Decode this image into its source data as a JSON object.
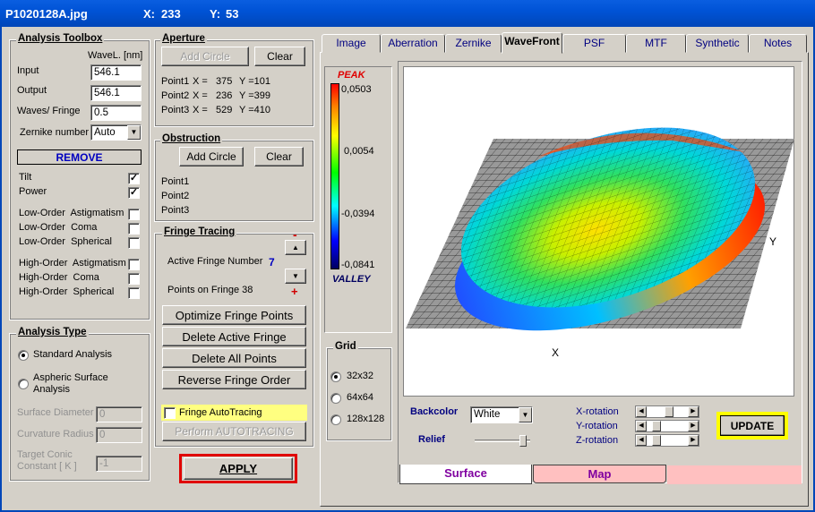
{
  "title": {
    "file": "P1020128A.jpg",
    "x_label": "X:",
    "x_value": "233",
    "y_label": "Y:",
    "y_value": "53"
  },
  "toolbox": {
    "title": "Analysis Toolbox",
    "wavel_header": "WaveL. [nm]",
    "input_label": "Input",
    "input_value": "546.1",
    "output_label": "Output",
    "output_value": "546.1",
    "waves_label": "Waves/ Fringe",
    "waves_value": "0.5",
    "zernike_label": "Zernike number",
    "zernike_value": "Auto",
    "remove": "REMOVE",
    "terms": [
      {
        "label": "Tilt",
        "checked": "✓"
      },
      {
        "label": "Power",
        "checked": "✓"
      },
      {
        "label": "Low-Order  Astigmatism",
        "checked": ""
      },
      {
        "label": "Low-Order  Coma",
        "checked": ""
      },
      {
        "label": "Low-Order  Spherical",
        "checked": ""
      },
      {
        "label": "High-Order  Astigmatism",
        "checked": ""
      },
      {
        "label": "High-Order  Coma",
        "checked": ""
      },
      {
        "label": "High-Order  Spherical",
        "checked": ""
      }
    ]
  },
  "aperture": {
    "title": "Aperture",
    "add_circle": "Add Circle",
    "clear": "Clear",
    "points": [
      {
        "label": "Point1",
        "x": "X =   375",
        "y": "Y =101"
      },
      {
        "label": "Point2",
        "x": "X =   236",
        "y": "Y =399"
      },
      {
        "label": "Point3",
        "x": "X =   529",
        "y": "Y =410"
      }
    ]
  },
  "obstruction": {
    "title": "Obstruction",
    "add_circle": "Add Circle",
    "clear": "Clear",
    "points": [
      "Point1",
      "Point2",
      "Point3"
    ]
  },
  "fringe": {
    "title": "Fringe Tracing",
    "active_label": "Active Fringe Number",
    "active_value": "7",
    "minus": "-",
    "plus": "+",
    "points_label": "Points on  Fringe 38",
    "optimize": "Optimize Fringe Points",
    "delete_active": "Delete Active Fringe",
    "delete_all": "Delete  All  Points",
    "reverse": "Reverse  Fringe Order",
    "autotracing": "Fringe AutoTracing",
    "perform": "Perform  AUTOTRACING"
  },
  "analysis": {
    "title": "Analysis Type",
    "standard": "Standard  Analysis",
    "aspheric": "Aspheric  Surface\nAnalysis",
    "surface_diameter": "Surface Diameter",
    "surface_diameter_value": "0",
    "curvature_radius": "Curvature Radius",
    "curvature_radius_value": "0",
    "target_conic": "Target Conic\nConstant [ K ]",
    "target_conic_value": "-1"
  },
  "apply": "APPLY",
  "tabs": [
    "Image",
    "Aberration",
    "Zernike",
    "WaveFront",
    "PSF",
    "MTF",
    "Synthetic",
    "Notes"
  ],
  "active_tab": "WaveFront",
  "colorbar": {
    "peak": "PEAK",
    "valley": "VALLEY",
    "ticks": [
      "0,0503",
      "0,0054",
      "-0,0394",
      "-0,0841"
    ]
  },
  "grid": {
    "title": "Grid",
    "options": [
      "32x32",
      "64x64",
      "128x128"
    ],
    "selected": "32x32"
  },
  "plot": {
    "x_axis": "X",
    "y_axis": "Y"
  },
  "controls": {
    "backcolor_label": "Backcolor",
    "backcolor_value": "White",
    "relief_label": "Relief",
    "x_rot": "X-rotation",
    "y_rot": "Y-rotation",
    "z_rot": "Z-rotation",
    "update": "UPDATE"
  },
  "subtabs": [
    "Surface",
    "Map"
  ]
}
